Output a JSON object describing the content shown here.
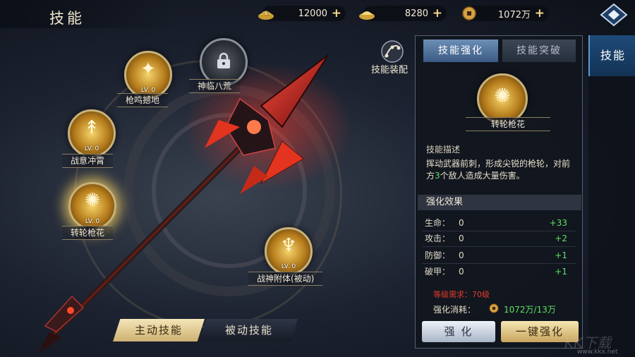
{
  "header": {
    "title": "技能"
  },
  "resources": [
    {
      "icon": "gold-ingot-icon",
      "value": "12000"
    },
    {
      "icon": "silver-ingot-icon",
      "value": "8280"
    },
    {
      "icon": "copper-coin-icon",
      "value": "1072万"
    }
  ],
  "skills": [
    {
      "name": "神临八荒",
      "level": "",
      "locked": true
    },
    {
      "name": "枪鸣撼地",
      "level": "LV. 0"
    },
    {
      "name": "战意冲霄",
      "level": "LV. 0"
    },
    {
      "name": "转轮枪花",
      "level": "LV. 0",
      "active": true
    },
    {
      "name": "战神附体(被动)",
      "level": "LV. 0"
    }
  ],
  "bottom_tabs": {
    "active": "主动技能",
    "passive": "被动技能"
  },
  "equip": {
    "label": "技能装配"
  },
  "panel": {
    "tabs": {
      "enhance": "技能强化",
      "breakthrough": "技能突破"
    },
    "skill_name": "转轮枪花",
    "desc_label": "技能描述",
    "desc_part1": "挥动武器前刺，形成尖锐的枪轮，对前方",
    "desc_highlight": "3",
    "desc_part2": "个敌人造成大量伤害。",
    "effect_label": "强化效果",
    "stats": [
      {
        "name": "生命：",
        "value": "0",
        "gain": "+33"
      },
      {
        "name": "攻击：",
        "value": "0",
        "gain": "+2"
      },
      {
        "name": "防御：",
        "value": "0",
        "gain": "+1"
      },
      {
        "name": "破甲：",
        "value": "0",
        "gain": "+1"
      }
    ],
    "requirement": "等级需求：70级",
    "cost_label": "强化消耗：",
    "cost_value": "1072万/13万",
    "buttons": {
      "enhance": "强 化",
      "one_click": "一键强化"
    }
  },
  "side_tab": {
    "label": "技能"
  },
  "watermark": {
    "text": "KK下载",
    "url": "www.kkx.net"
  },
  "colors": {
    "accent_gold": "#cdb172",
    "highlight_green": "#5ee065",
    "requirement_red": "#e43c2c",
    "panel_blue": "#3a5a84"
  }
}
